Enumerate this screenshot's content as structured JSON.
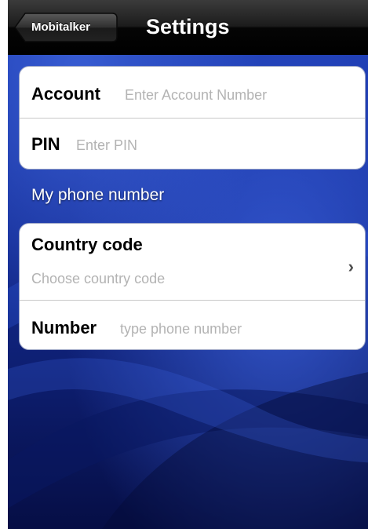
{
  "navbar": {
    "back_label": "Mobitalker",
    "title": "Settings"
  },
  "login_group": {
    "account": {
      "label": "Account",
      "placeholder": "Enter Account Number"
    },
    "pin": {
      "label": "PIN",
      "placeholder": "Enter PIN"
    }
  },
  "phone_section": {
    "header": "My phone number",
    "country_code": {
      "label": "Country code",
      "placeholder": "Choose country code"
    },
    "number": {
      "label": "Number",
      "placeholder": "type phone number"
    }
  },
  "icons": {
    "disclosure": "chevron-right-icon"
  },
  "colors": {
    "background": "#0a1a6e",
    "navbar": "#000000",
    "placeholder": "#b3b3b3"
  }
}
